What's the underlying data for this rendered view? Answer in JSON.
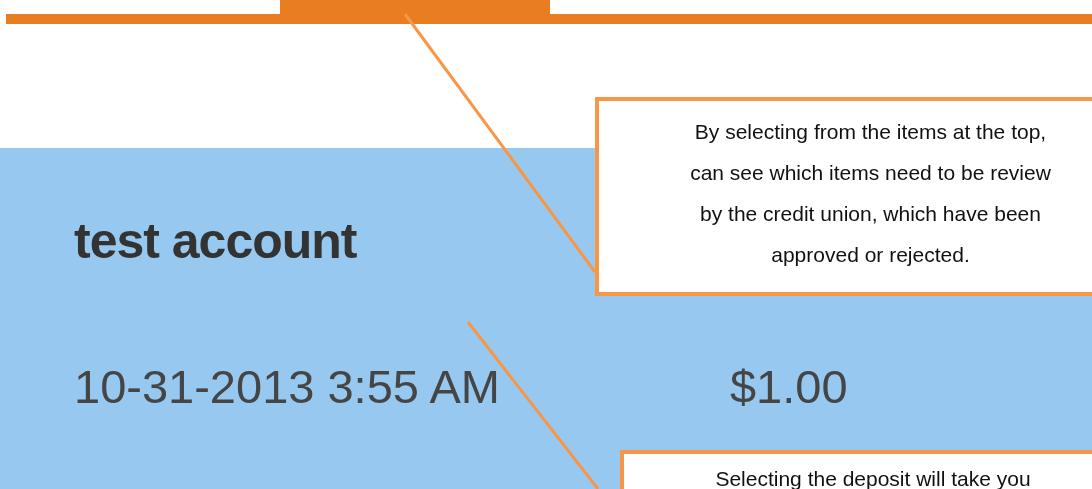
{
  "account": {
    "name": "test account"
  },
  "deposit": {
    "datetime": "10-31-2013 3:55 AM",
    "amount": "$1.00"
  },
  "callouts": [
    {
      "lines": [
        "By selecting from the items at the top,",
        "can see which items need to be review",
        "by the credit union, which have been",
        "approved or rejected."
      ]
    },
    {
      "lines": [
        "Selecting the deposit will take you"
      ]
    }
  ]
}
